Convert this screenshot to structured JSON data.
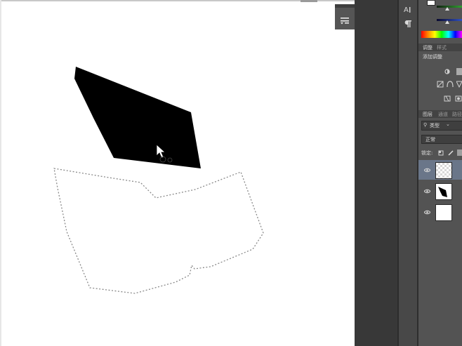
{
  "adjustments_panel": {
    "tab_active": "调整",
    "tab_inactive": "样式",
    "title": "添加调整"
  },
  "layers_panel": {
    "tab_active": "图层",
    "tab_2": "通道",
    "tab_3": "路径",
    "filter_kind": "类型",
    "blend_mode": "正常",
    "lock_label": "锁定:",
    "layers": [
      {
        "thumb": "checker",
        "active": true
      },
      {
        "thumb": "black-shape",
        "active": false
      },
      {
        "thumb": "white",
        "active": false
      }
    ]
  },
  "colors": {
    "panel_bg": "#535353",
    "shape_fill": "#000000",
    "selected_layer": "#6a7689"
  }
}
